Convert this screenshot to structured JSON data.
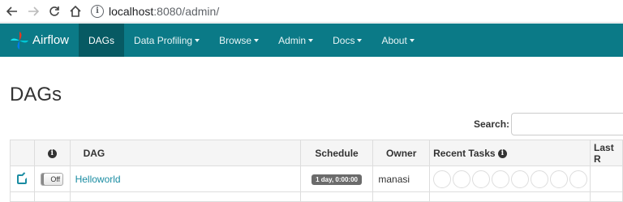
{
  "browser": {
    "url_host": "localhost",
    "url_path": ":8080/admin/"
  },
  "navbar": {
    "brand": "Airflow",
    "items": [
      {
        "label": "DAGs",
        "active": true,
        "dropdown": false
      },
      {
        "label": "Data Profiling",
        "active": false,
        "dropdown": true
      },
      {
        "label": "Browse",
        "active": false,
        "dropdown": true
      },
      {
        "label": "Admin",
        "active": false,
        "dropdown": true
      },
      {
        "label": "Docs",
        "active": false,
        "dropdown": true
      },
      {
        "label": "About",
        "active": false,
        "dropdown": true
      }
    ]
  },
  "page": {
    "title": "DAGs",
    "search_label": "Search:"
  },
  "table": {
    "headers": {
      "info_icon": "i",
      "dag": "DAG",
      "schedule": "Schedule",
      "owner": "Owner",
      "recent_tasks": "Recent Tasks",
      "recent_tasks_icon": "i",
      "last_run": "Last R"
    },
    "rows": [
      {
        "toggle": "Off",
        "dag": "Helloworld",
        "schedule": "1 day, 0:00:00",
        "owner": "manasi"
      }
    ]
  },
  "colors": {
    "navbar": "#0b7a87",
    "navbar_active": "#075a63",
    "link": "#1a8ca2",
    "schedule_badge": "#6b6b6b"
  },
  "icons": [
    "back-arrow-icon",
    "forward-arrow-icon",
    "reload-icon",
    "home-icon",
    "site-info-icon",
    "airflow-logo-icon",
    "edit-icon",
    "info-icon"
  ]
}
